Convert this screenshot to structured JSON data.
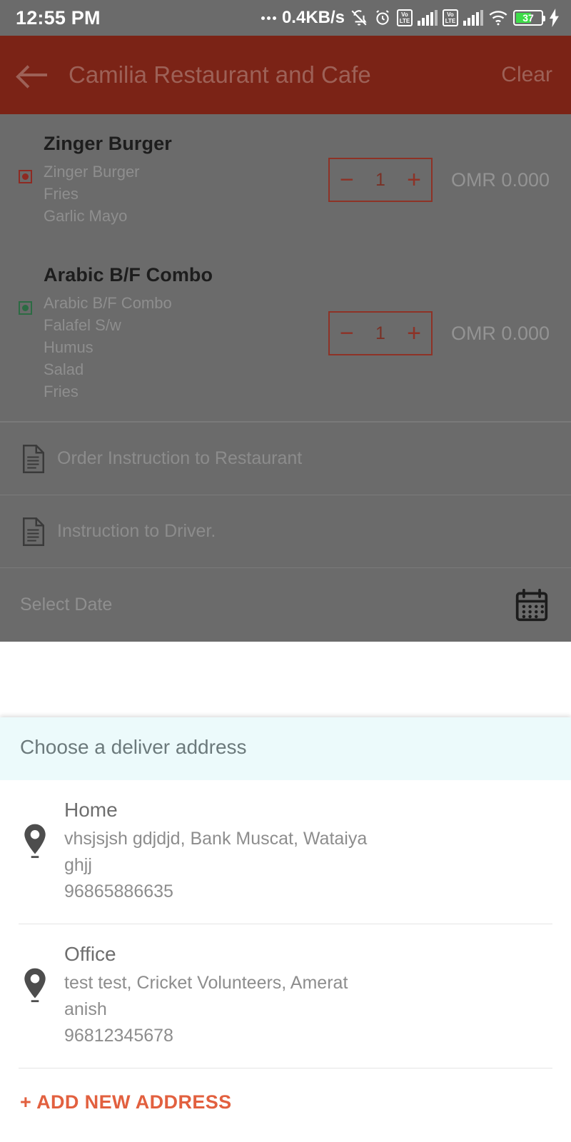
{
  "statusbar": {
    "time": "12:55 PM",
    "network_speed": "0.4KB/s",
    "volte_label_top": "Vo",
    "volte_label_bottom": "LTE",
    "battery_percent": "37",
    "icons": [
      "dots-icon",
      "bell-muted-icon",
      "alarm-clock-icon",
      "volte-icon",
      "signal-bars-icon",
      "volte-icon",
      "signal-bars-icon",
      "wifi-icon",
      "battery-icon",
      "charging-bolt-icon"
    ]
  },
  "appbar": {
    "back_icon": "back-arrow-icon",
    "title": "Camilia Restaurant and Cafe",
    "clear_label": "Clear"
  },
  "cart": {
    "items": [
      {
        "name": "Zinger Burger",
        "diet": "nonveg",
        "options": [
          "Zinger Burger",
          "Fries",
          "Garlic Mayo"
        ],
        "minus": "−",
        "qty": "1",
        "plus": "+",
        "price": "OMR 0.000"
      },
      {
        "name": "Arabic B/F Combo",
        "diet": "veg",
        "options": [
          "Arabic B/F Combo",
          "Falafel S/w",
          "Humus",
          "Salad",
          "Fries"
        ],
        "minus": "−",
        "qty": "1",
        "plus": "+",
        "price": "OMR 0.000"
      }
    ],
    "instructions": [
      {
        "icon": "document-icon",
        "label": "Order Instruction to Restaurant"
      },
      {
        "icon": "document-icon",
        "label": "Instruction to Driver."
      }
    ],
    "date_row": {
      "label": "Select Date",
      "icon": "calendar-icon"
    }
  },
  "address_sheet": {
    "title": "Choose a deliver address",
    "addresses": [
      {
        "label": "Home",
        "line1": "vhsjsjsh  gdjdjd, Bank Muscat, Wataiya",
        "line2": "ghjj",
        "phone": "96865886635",
        "icon": "location-pin-icon"
      },
      {
        "label": "Office",
        "line1": "test  test, Cricket Volunteers, Amerat",
        "line2": "anish",
        "phone": "96812345678",
        "icon": "location-pin-icon"
      }
    ],
    "add_new_label": "+ ADD NEW ADDRESS"
  },
  "colors": {
    "appbar": "#7b2316",
    "scrim": "#6b6b6b",
    "accent": "#e2603f",
    "stepper_border": "#8e3226",
    "sheet_header": "#ecfafb",
    "veg": "#2c6b43",
    "nonveg": "#8e2a22",
    "battery": "#3ddc49"
  }
}
